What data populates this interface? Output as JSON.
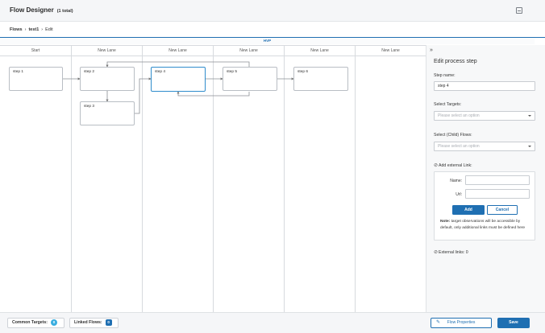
{
  "header": {
    "title": "Flow Designer",
    "count": "(1 total)",
    "save_icon": "save-icon"
  },
  "breadcrumb": {
    "root": "Flows",
    "flow": "test1",
    "current": "Edit",
    "separator": "›"
  },
  "pool": {
    "name": "HVP"
  },
  "lanes": [
    "Start",
    "New Lane",
    "New Lane",
    "New Lane",
    "New Lane",
    "New Lane"
  ],
  "steps": [
    "step 1",
    "step 2",
    "step 3",
    "step 4",
    "step 5",
    "step 6"
  ],
  "panel": {
    "collapse_icon": "double-chevron-right-icon",
    "title": "Edit process step",
    "step_name_label": "Step name:",
    "step_name_value": "step 4",
    "targets_label": "Select Targets:",
    "targets_placeholder": "Please select an option",
    "flows_label": "Select (Child) Flows:",
    "flows_placeholder": "Please select an option",
    "ext_link_label": "Add external Link:",
    "name_label": "Name:",
    "url_label": "Url:",
    "add_label": "Add",
    "cancel_label": "Cancel",
    "note_bold": "Note:",
    "note_text": " target observations will be accessible by default, only additional links must be defined here",
    "ext_links_count": "External links: 0"
  },
  "footer": {
    "common_targets_label": "Common Targets:",
    "common_targets_count": "0",
    "linked_flows_label": "Linked Flows:",
    "linked_flows_count": "0",
    "flow_properties_label": "Flow Properties",
    "save_label": "Save"
  },
  "colors": {
    "accent": "#1f6fb2",
    "active_step": "#2f8ccc",
    "badge_teal": "#39aee0"
  }
}
